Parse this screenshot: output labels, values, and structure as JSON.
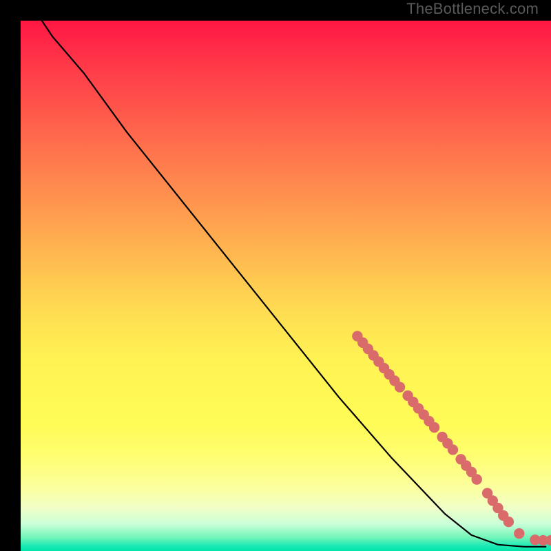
{
  "watermark": "TheBottleneck.com",
  "chart_data": {
    "type": "line",
    "title": "",
    "xlabel": "",
    "ylabel": "",
    "xlim": [
      0,
      100
    ],
    "ylim": [
      0,
      100
    ],
    "grid": false,
    "legend": false,
    "background_gradient": {
      "top": "#ff1744",
      "mid": "#fff253",
      "bottom": "#00e5a8"
    },
    "curve": [
      {
        "x": 4,
        "y": 100
      },
      {
        "x": 6,
        "y": 97
      },
      {
        "x": 9,
        "y": 93.5
      },
      {
        "x": 12,
        "y": 90
      },
      {
        "x": 20,
        "y": 79
      },
      {
        "x": 30,
        "y": 66.5
      },
      {
        "x": 40,
        "y": 54
      },
      {
        "x": 50,
        "y": 41.5
      },
      {
        "x": 60,
        "y": 29
      },
      {
        "x": 70,
        "y": 17.5
      },
      {
        "x": 80,
        "y": 7
      },
      {
        "x": 85,
        "y": 3
      },
      {
        "x": 90,
        "y": 1.2
      },
      {
        "x": 95,
        "y": 0.8
      },
      {
        "x": 99,
        "y": 0.8
      }
    ],
    "markers": [
      {
        "x": 63.5,
        "y": 40.5
      },
      {
        "x": 64.5,
        "y": 39.3
      },
      {
        "x": 65.5,
        "y": 38.1
      },
      {
        "x": 66.5,
        "y": 36.9
      },
      {
        "x": 67.5,
        "y": 35.7
      },
      {
        "x": 68.5,
        "y": 34.5
      },
      {
        "x": 69.5,
        "y": 33.3
      },
      {
        "x": 70.5,
        "y": 32.1
      },
      {
        "x": 71.5,
        "y": 30.9
      },
      {
        "x": 73,
        "y": 29.3
      },
      {
        "x": 74,
        "y": 28.1
      },
      {
        "x": 75,
        "y": 26.9
      },
      {
        "x": 76,
        "y": 25.7
      },
      {
        "x": 77,
        "y": 24.5
      },
      {
        "x": 78,
        "y": 23.3
      },
      {
        "x": 79.5,
        "y": 21.5
      },
      {
        "x": 80.5,
        "y": 20.3
      },
      {
        "x": 81.5,
        "y": 19.1
      },
      {
        "x": 83,
        "y": 17.3
      },
      {
        "x": 84,
        "y": 16.1
      },
      {
        "x": 85,
        "y": 14.9
      },
      {
        "x": 86,
        "y": 13.5
      },
      {
        "x": 88,
        "y": 10.9
      },
      {
        "x": 89,
        "y": 9.5
      },
      {
        "x": 90,
        "y": 8.1
      },
      {
        "x": 91,
        "y": 6.7
      },
      {
        "x": 92,
        "y": 5.5
      },
      {
        "x": 94,
        "y": 3.3
      },
      {
        "x": 97,
        "y": 2.1
      },
      {
        "x": 98.5,
        "y": 2.0
      },
      {
        "x": 100,
        "y": 2.0
      }
    ],
    "marker_radius_pct": 1.0,
    "marker_color": "#d96b6b",
    "line_color": "#000000"
  }
}
